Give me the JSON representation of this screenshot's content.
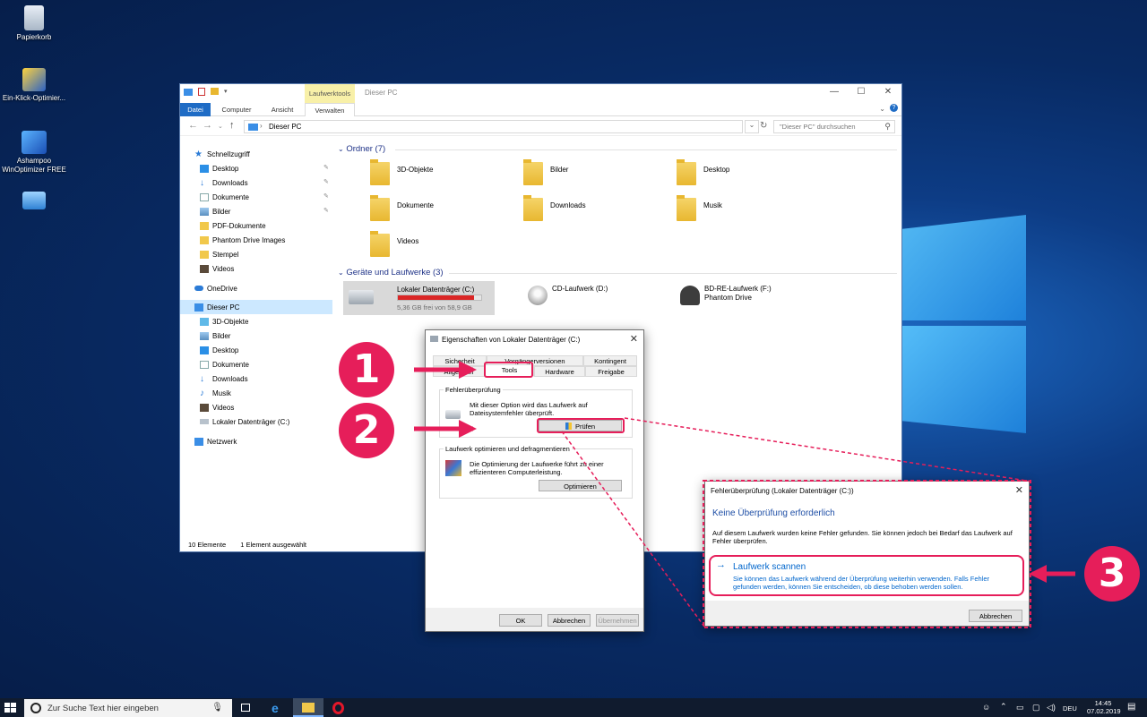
{
  "desktop": {
    "icons": [
      {
        "label": "Papierkorb"
      },
      {
        "label": "Ein-Klick-Optimier..."
      },
      {
        "label": "Ashampoo WinOptimizer FREE"
      },
      {
        "label": ""
      }
    ]
  },
  "explorer": {
    "title": "Dieser PC",
    "contextual_tab": "Laufwerktools",
    "ribbon_tabs": [
      "Datei",
      "Computer",
      "Ansicht",
      "Verwalten"
    ],
    "address": "Dieser PC",
    "search_placeholder": "\"Dieser PC\" durchsuchen",
    "nav": {
      "quick_access": "Schnellzugriff",
      "quick_items": [
        "Desktop",
        "Downloads",
        "Dokumente",
        "Bilder",
        "PDF-Dokumente",
        "Phantom Drive Images",
        "Stempel",
        "Videos"
      ],
      "onedrive": "OneDrive",
      "this_pc": "Dieser PC",
      "pc_items": [
        "3D-Objekte",
        "Bilder",
        "Desktop",
        "Dokumente",
        "Downloads",
        "Musik",
        "Videos",
        "Lokaler Datenträger (C:)"
      ],
      "network": "Netzwerk"
    },
    "folders_header": "Ordner (7)",
    "folders": [
      "3D-Objekte",
      "Bilder",
      "Desktop",
      "Dokumente",
      "Downloads",
      "Musik",
      "Videos"
    ],
    "drives_header": "Geräte und Laufwerke (3)",
    "drives": [
      {
        "name": "Lokaler Datenträger (C:)",
        "detail": "5,36 GB frei von 58,9 GB",
        "used_fraction": 0.91
      },
      {
        "name": "CD-Laufwerk (D:)",
        "detail": ""
      },
      {
        "name": "BD-RE-Laufwerk (F:)",
        "detail": "Phantom Drive"
      }
    ],
    "status": {
      "items": "10 Elemente",
      "selected": "1 Element ausgewählt"
    }
  },
  "properties": {
    "title": "Eigenschaften von Lokaler Datenträger (C:)",
    "tabs_row1": [
      "Sicherheit",
      "Vorgängerversionen",
      "Kontingent"
    ],
    "tabs_row2": [
      "Allgemein",
      "Tools",
      "Hardware",
      "Freigabe"
    ],
    "error_group": "Fehlerüberprüfung",
    "error_text": "Mit dieser Option wird das Laufwerk auf Dateisystemfehler überprüft.",
    "check_button": "Prüfen",
    "optimize_group": "Laufwerk optimieren und defragmentieren",
    "optimize_text": "Die Optimierung der Laufwerke führt zu einer effizienteren Computerleistung.",
    "optimize_button": "Optimieren",
    "ok": "OK",
    "cancel": "Abbrechen",
    "apply": "Übernehmen"
  },
  "scan": {
    "title": "Fehlerüberprüfung (Lokaler Datenträger (C:))",
    "heading": "Keine Überprüfung erforderlich",
    "body": "Auf diesem Laufwerk wurden keine Fehler gefunden. Sie können jedoch bei Bedarf das Laufwerk auf Fehler überprüfen.",
    "action_title": "Laufwerk scannen",
    "action_text": "Sie können das Laufwerk während der Überprüfung weiterhin verwenden. Falls Fehler gefunden werden, können Sie entscheiden, ob diese behoben werden sollen.",
    "cancel": "Abbrechen"
  },
  "annotations": [
    "1",
    "2",
    "3"
  ],
  "taskbar": {
    "search_placeholder": "Zur Suche Text hier eingeben",
    "language": "DEU",
    "time": "14:45",
    "date": "07.02.2019"
  },
  "colors": {
    "accent": "#e61e5a",
    "explorer_blue": "#1f6cc5",
    "link_blue": "#0066cc"
  }
}
